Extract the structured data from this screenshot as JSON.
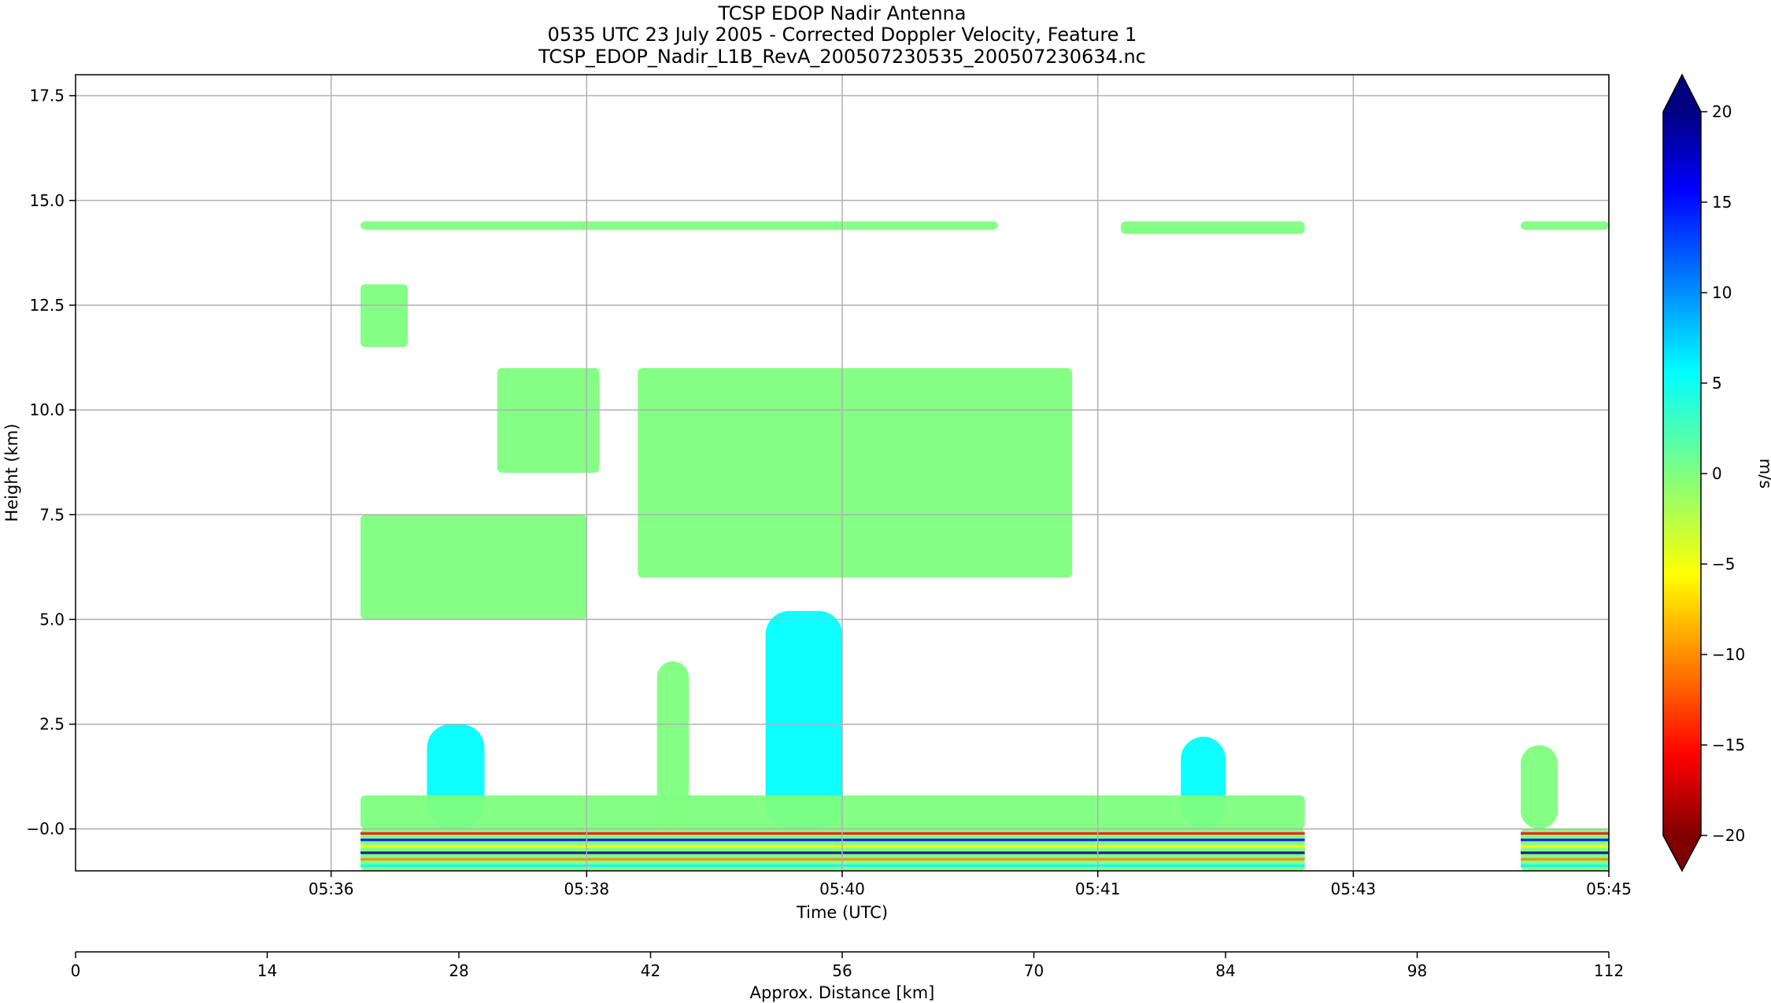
{
  "chart_data": {
    "type": "heatmap",
    "title_lines": [
      "TCSP EDOP Nadir Antenna",
      "0535 UTC 23 July 2005 - Corrected Doppler Velocity, Feature 1",
      "TCSP_EDOP_Nadir_L1B_RevA_200507230535_200507230634.nc"
    ],
    "xlabel": "Time (UTC)",
    "ylabel": "Height (km)",
    "x2label": "Approx. Distance [km]",
    "x_time_ticks": [
      "05:36",
      "05:38",
      "05:40",
      "05:41",
      "05:43",
      "05:45"
    ],
    "x_time_tick_positions": [
      20,
      40,
      60,
      80,
      100,
      120
    ],
    "xlim": [
      0,
      120
    ],
    "ylim": [
      -1.0,
      18.0
    ],
    "y_ticks": [
      {
        "value": -0.0,
        "label": "−0.0"
      },
      {
        "value": 2.5,
        "label": "2.5"
      },
      {
        "value": 5.0,
        "label": "5.0"
      },
      {
        "value": 7.5,
        "label": "7.5"
      },
      {
        "value": 10.0,
        "label": "10.0"
      },
      {
        "value": 12.5,
        "label": "12.5"
      },
      {
        "value": 15.0,
        "label": "15.0"
      },
      {
        "value": 17.5,
        "label": "17.5"
      }
    ],
    "distance_ticks": [
      0,
      14,
      28,
      42,
      56,
      70,
      84,
      98,
      112
    ],
    "distance_lim": [
      0,
      112
    ],
    "grid": true,
    "colorbar": {
      "label": "m/s",
      "vmin": -20,
      "vmax": 20,
      "extend": "both",
      "ticks": [
        {
          "value": 20,
          "label": "20"
        },
        {
          "value": 15,
          "label": "15"
        },
        {
          "value": 10,
          "label": "10"
        },
        {
          "value": 5,
          "label": "5"
        },
        {
          "value": 0,
          "label": "0"
        },
        {
          "value": -5,
          "label": "−5"
        },
        {
          "value": -10,
          "label": "−10"
        },
        {
          "value": -15,
          "label": "−15"
        },
        {
          "value": -20,
          "label": "−20"
        }
      ],
      "colormap": "jet_reversed",
      "colors": [
        "#800000",
        "#ff0000",
        "#ff8000",
        "#ffff00",
        "#80ff80",
        "#00ffff",
        "#0080ff",
        "#0000ff",
        "#000080"
      ]
    },
    "features": [
      {
        "name": "anvil-layer-14km",
        "x_range": [
          22.3,
          72.2
        ],
        "y_range": [
          14.3,
          14.5
        ],
        "velocity": -1
      },
      {
        "name": "anvil-layer-14km-b",
        "x_range": [
          81.8,
          96.2
        ],
        "y_range": [
          14.2,
          14.5
        ],
        "velocity": -1
      },
      {
        "name": "anvil-layer-14km-c",
        "x_range": [
          113.1,
          120.0
        ],
        "y_range": [
          14.3,
          14.5
        ],
        "velocity": -1
      },
      {
        "name": "main-stratiform-cloud",
        "x_range": [
          44.0,
          78.0
        ],
        "y_range": [
          6.0,
          11.0
        ],
        "velocity": 0
      },
      {
        "name": "cloud-left-mid",
        "x_range": [
          22.3,
          40.0
        ],
        "y_range": [
          5.0,
          7.5
        ],
        "velocity": 0
      },
      {
        "name": "cloud-upper-left",
        "x_range": [
          22.3,
          26.0
        ],
        "y_range": [
          11.5,
          13.0
        ],
        "velocity": 0
      },
      {
        "name": "cloud-mid-left",
        "x_range": [
          33.0,
          41.0
        ],
        "y_range": [
          8.5,
          11.0
        ],
        "velocity": 0
      },
      {
        "name": "convective-core",
        "x_range": [
          54.0,
          60.0
        ],
        "y_range": [
          0.0,
          5.2
        ],
        "velocity": 5
      },
      {
        "name": "shallow-cell-1",
        "x_range": [
          27.5,
          32.0
        ],
        "y_range": [
          0.0,
          2.5
        ],
        "velocity": 4
      },
      {
        "name": "shallow-cell-2",
        "x_range": [
          45.5,
          48.0
        ],
        "y_range": [
          0.0,
          4.0
        ],
        "velocity": 2
      },
      {
        "name": "shallow-cell-3",
        "x_range": [
          86.5,
          90.0
        ],
        "y_range": [
          0.0,
          2.2
        ],
        "velocity": 3
      },
      {
        "name": "shallow-cell-4",
        "x_range": [
          113.1,
          116.0
        ],
        "y_range": [
          0.0,
          2.0
        ],
        "velocity": 2
      },
      {
        "name": "boundary-layer",
        "x_range": [
          22.3,
          96.2
        ],
        "y_range": [
          0.0,
          0.8
        ],
        "velocity": 0
      },
      {
        "name": "surface-clutter",
        "x_range": [
          22.3,
          96.2
        ],
        "y_range": [
          -1.0,
          0.0
        ],
        "velocity": 0
      },
      {
        "name": "surface-clutter-right",
        "x_range": [
          113.1,
          120.0
        ],
        "y_range": [
          -1.0,
          0.0
        ],
        "velocity": 0
      }
    ]
  }
}
